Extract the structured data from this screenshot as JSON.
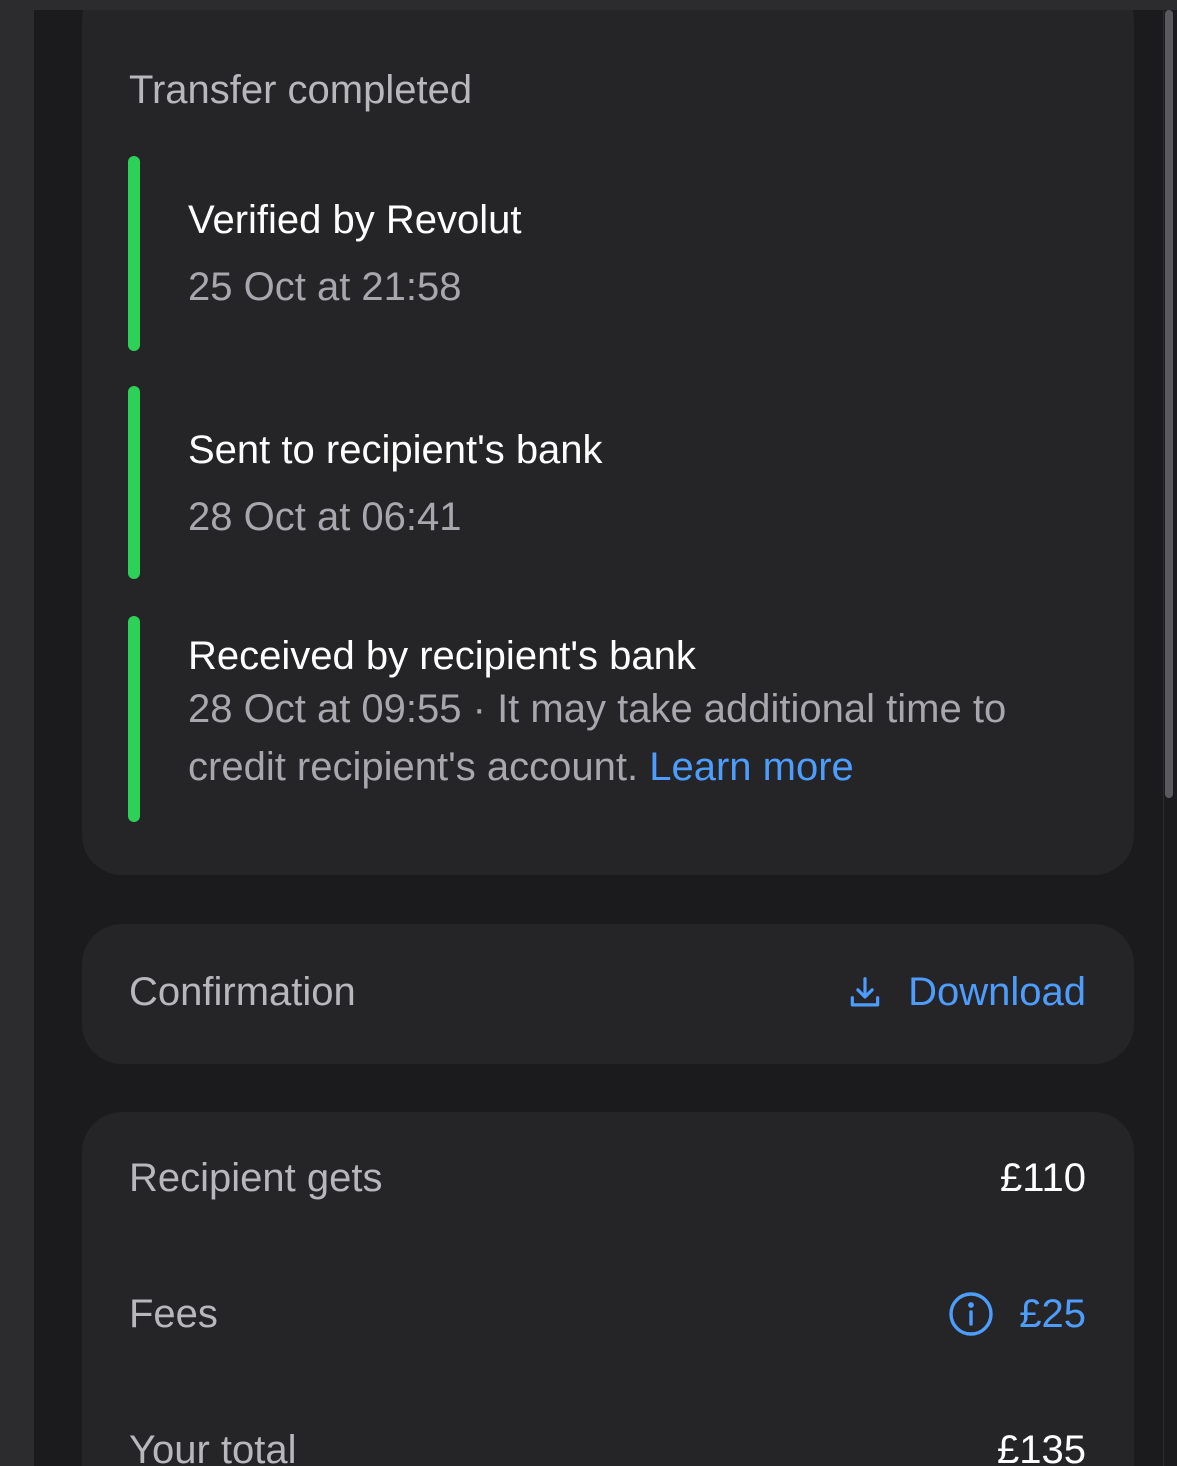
{
  "status_card": {
    "title": "Transfer completed",
    "steps": [
      {
        "title": "Verified by Revolut",
        "time": "25 Oct at 21:58"
      },
      {
        "title": "Sent to recipient's bank",
        "time": "28 Oct at 06:41"
      },
      {
        "title": "Received by recipient's bank",
        "time": "28 Oct at 09:55",
        "separator": " · ",
        "note": "It may take additional time to credit recipient's account.",
        "link": "Learn more"
      }
    ],
    "step_color": "#2ed158"
  },
  "confirmation": {
    "label": "Confirmation",
    "action_label": "Download",
    "action_icon": "download-icon"
  },
  "amounts": {
    "rows": [
      {
        "label": "Recipient gets",
        "value": "£110"
      },
      {
        "label": "Fees",
        "value": "£25",
        "icon": "info-icon"
      },
      {
        "label": "Your total",
        "value": "£135"
      }
    ]
  },
  "colors": {
    "accent": "#4d9dff",
    "success": "#2ed158",
    "background": "#1b1b1e",
    "card": "#252527"
  }
}
